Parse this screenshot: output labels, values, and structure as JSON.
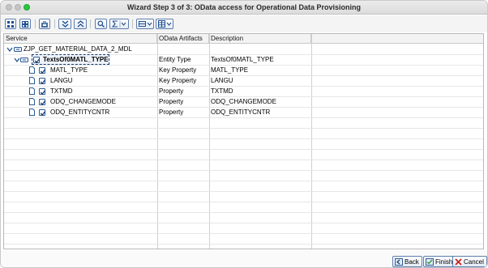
{
  "window": {
    "title": "Wizard Step 3 of 3: OData access for Operational Data Provisioning"
  },
  "toolbar": {
    "buttons": [
      "expand-all-icon",
      "collapse-all-icon",
      "details-icon",
      "expand-subtree-icon",
      "collapse-subtree-icon",
      "find-icon",
      "sum-icon",
      "layout-icon",
      "grid-icon"
    ]
  },
  "grid": {
    "columns": [
      "Service",
      "OData Artifacts",
      "Description"
    ],
    "rows": [
      {
        "service": "ZJP_GET_MATERIAL_DATA_2_MDL",
        "artifact": "",
        "description": ""
      },
      {
        "service": "TextsOf0MATL_TYPE",
        "artifact": "Entity Type",
        "description": "TextsOf0MATL_TYPE"
      },
      {
        "service": "MATL_TYPE",
        "artifact": "Key Property",
        "description": "MATL_TYPE"
      },
      {
        "service": "LANGU",
        "artifact": "Key Property",
        "description": "LANGU"
      },
      {
        "service": "TXTMD",
        "artifact": "Property",
        "description": "TXTMD"
      },
      {
        "service": "ODQ_CHANGEMODE",
        "artifact": "Property",
        "description": "ODQ_CHANGEMODE"
      },
      {
        "service": "ODQ_ENTITYCNTR",
        "artifact": "Property",
        "description": "ODQ_ENTITYCNTR"
      }
    ]
  },
  "footer": {
    "back_label": "Back",
    "finish_label": "Finish",
    "cancel_label": "Cancel"
  },
  "colors": {
    "accent": "#2e5d94",
    "cancel_red": "#d0201a",
    "finish_green": "#2f9a3a"
  }
}
